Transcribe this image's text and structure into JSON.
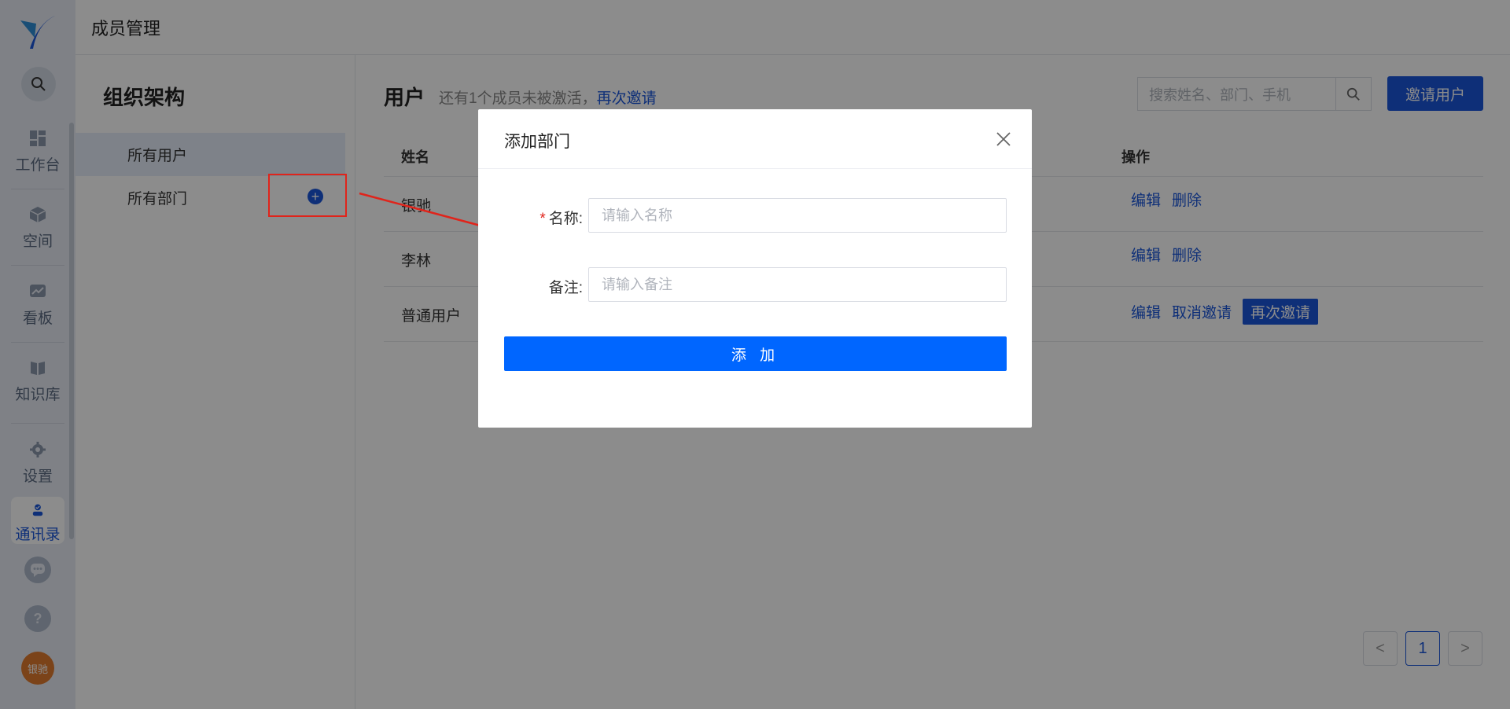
{
  "header": {
    "title": "成员管理"
  },
  "rail": {
    "items": [
      {
        "label": "工作台",
        "icon": "dashboard-icon"
      },
      {
        "label": "空间",
        "icon": "cube-icon"
      },
      {
        "label": "看板",
        "icon": "chart-icon"
      },
      {
        "label": "知识库",
        "icon": "book-icon"
      },
      {
        "label": "设置",
        "icon": "gear-icon"
      },
      {
        "label": "通讯录",
        "icon": "contacts-icon",
        "active": true
      }
    ],
    "avatar_text": "银驰"
  },
  "org": {
    "title": "组织架构",
    "items": [
      {
        "label": "所有用户",
        "active": true
      },
      {
        "label": "所有部门",
        "active": false
      }
    ]
  },
  "users": {
    "title": "用户",
    "notice": "还有1个成员未被激活，",
    "reinvite_link": "再次邀请",
    "search_placeholder": "搜索姓名、部门、手机",
    "invite_button": "邀请用户",
    "columns": {
      "name": "姓名",
      "ops": "操作"
    },
    "rows": [
      {
        "name": "银驰",
        "ops": [
          "编辑",
          "删除"
        ]
      },
      {
        "name": "李林",
        "ops": [
          "编辑",
          "删除"
        ]
      },
      {
        "name": "普通用户",
        "ops": [
          "编辑",
          "取消邀请",
          "再次邀请"
        ]
      }
    ]
  },
  "pagination": {
    "current": "1",
    "prev": "<",
    "next": ">"
  },
  "modal": {
    "title": "添加部门",
    "name_label": "名称:",
    "name_placeholder": "请输入名称",
    "note_label": "备注:",
    "note_placeholder": "请输入备注",
    "submit": "添 加"
  },
  "colors": {
    "primary": "#1a56db",
    "submit": "#0066ff",
    "annotation": "#e0241b"
  }
}
